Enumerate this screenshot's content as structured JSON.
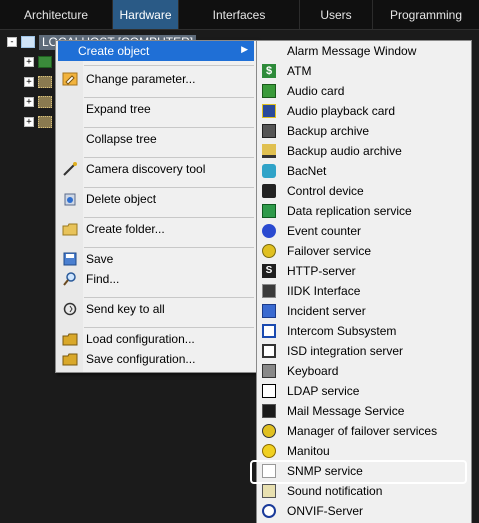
{
  "tabs": [
    {
      "label": "Architecture",
      "active": false
    },
    {
      "label": "Hardware",
      "active": true
    },
    {
      "label": "Interfaces",
      "active": false
    },
    {
      "label": "Users",
      "active": false
    },
    {
      "label": "Programming",
      "active": false
    }
  ],
  "tree": {
    "root_label": "LOCALHOST [COMPUTER]",
    "expander_root": "-",
    "expander_child": "+"
  },
  "context_menu": {
    "items": [
      {
        "label": "Create object",
        "icon": "none",
        "highlighted": true,
        "has_submenu": true,
        "arrow": "▶"
      },
      {
        "label": "Change parameter...",
        "icon": "edit-icon"
      },
      {
        "label": "Expand tree",
        "icon": "none"
      },
      {
        "label": "Collapse tree",
        "icon": "none"
      },
      {
        "label": "Camera discovery tool",
        "icon": "wand-icon"
      },
      {
        "label": "Delete object",
        "icon": "recycle-bin-icon"
      },
      {
        "label": "Create folder...",
        "icon": "folder-add-icon"
      },
      {
        "label": "Save",
        "icon": "save-icon"
      },
      {
        "label": "Find...",
        "icon": "magnifier-icon"
      },
      {
        "label": "Send key to all",
        "icon": "key-cycle-icon"
      },
      {
        "label": "Load configuration...",
        "icon": "folder-load-icon"
      },
      {
        "label": "Save configuration...",
        "icon": "folder-save-icon"
      }
    ]
  },
  "submenu": {
    "items": [
      {
        "label": "Alarm Message Window",
        "icon": "none"
      },
      {
        "label": "ATM",
        "icon": "dollar-icon"
      },
      {
        "label": "Audio card",
        "icon": "audio-card-icon"
      },
      {
        "label": "Audio playback card",
        "icon": "audio-playback-card-icon"
      },
      {
        "label": "Backup archive",
        "icon": "backup-archive-icon"
      },
      {
        "label": "Backup audio archive",
        "icon": "backup-audio-archive-icon"
      },
      {
        "label": "BacNet",
        "icon": "bacnet-icon"
      },
      {
        "label": "Control device",
        "icon": "control-device-icon"
      },
      {
        "label": "Data replication service",
        "icon": "data-replication-icon"
      },
      {
        "label": "Event counter",
        "icon": "event-counter-icon"
      },
      {
        "label": "Failover service",
        "icon": "failover-icon"
      },
      {
        "label": "HTTP-server",
        "icon": "http-server-icon"
      },
      {
        "label": "IIDK Interface",
        "icon": "iidk-icon"
      },
      {
        "label": "Incident server",
        "icon": "incident-server-icon"
      },
      {
        "label": "Intercom Subsystem",
        "icon": "intercom-icon"
      },
      {
        "label": "ISD integration server",
        "icon": "isd-icon"
      },
      {
        "label": "Keyboard",
        "icon": "keyboard-icon"
      },
      {
        "label": "LDAP service",
        "icon": "ldap-icon"
      },
      {
        "label": "Mail Message Service",
        "icon": "mail-icon"
      },
      {
        "label": "Manager of failover services",
        "icon": "failover-manager-icon"
      },
      {
        "label": "Manitou",
        "icon": "manitou-icon"
      },
      {
        "label": "SNMP service",
        "icon": "snmp-icon"
      },
      {
        "label": "Sound notification",
        "icon": "sound-notification-icon"
      },
      {
        "label": "ONVIF-Server",
        "icon": "onvif-icon"
      }
    ],
    "highlight_outline_item": "SNMP service"
  },
  "colors": {
    "background": "#1b1b1b",
    "active_tab": "#2a5a86",
    "menu_highlight": "#1f6fd6",
    "menu_bg": "#f0f0f0"
  }
}
